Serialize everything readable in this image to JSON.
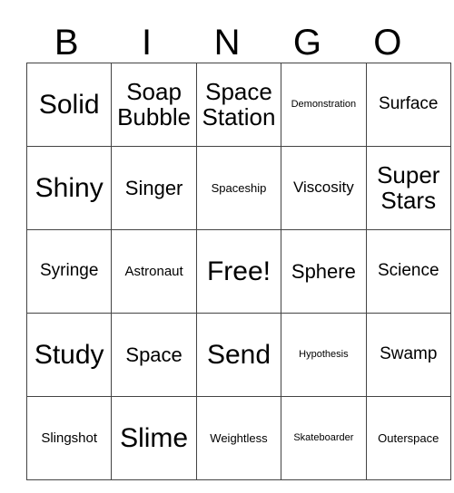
{
  "card": {
    "header": {
      "letters": [
        "B",
        "I",
        "N",
        "G",
        "O"
      ]
    },
    "rows": [
      {
        "cells": [
          {
            "label": "Solid",
            "size": "fs-xxl"
          },
          {
            "label": "Soap Bubble",
            "size": "fs-xl"
          },
          {
            "label": "Space Station",
            "size": "fs-xl"
          },
          {
            "label": "Demonstration",
            "size": "fs-tiny"
          },
          {
            "label": "Surface",
            "size": "fs-m"
          }
        ]
      },
      {
        "cells": [
          {
            "label": "Shiny",
            "size": "fs-xxl"
          },
          {
            "label": "Singer",
            "size": "fs-l"
          },
          {
            "label": "Spaceship",
            "size": "fs-xxs"
          },
          {
            "label": "Viscosity",
            "size": "fs-s"
          },
          {
            "label": "Super Stars",
            "size": "fs-xl"
          }
        ]
      },
      {
        "cells": [
          {
            "label": "Syringe",
            "size": "fs-m"
          },
          {
            "label": "Astronaut",
            "size": "fs-xs"
          },
          {
            "label": "Free!",
            "size": "fs-xxl"
          },
          {
            "label": "Sphere",
            "size": "fs-l"
          },
          {
            "label": "Science",
            "size": "fs-m"
          }
        ]
      },
      {
        "cells": [
          {
            "label": "Study",
            "size": "fs-xxl"
          },
          {
            "label": "Space",
            "size": "fs-l"
          },
          {
            "label": "Send",
            "size": "fs-xxl"
          },
          {
            "label": "Hypothesis",
            "size": "fs-tiny"
          },
          {
            "label": "Swamp",
            "size": "fs-m"
          }
        ]
      },
      {
        "cells": [
          {
            "label": "Slingshot",
            "size": "fs-xs"
          },
          {
            "label": "Slime",
            "size": "fs-xxl"
          },
          {
            "label": "Weightless",
            "size": "fs-xxs"
          },
          {
            "label": "Skateboarder",
            "size": "fs-tiny"
          },
          {
            "label": "Outerspace",
            "size": "fs-xxs"
          }
        ]
      }
    ]
  },
  "colors": {
    "background": "#ffffff",
    "text": "#000000",
    "grid_line": "#444444"
  }
}
